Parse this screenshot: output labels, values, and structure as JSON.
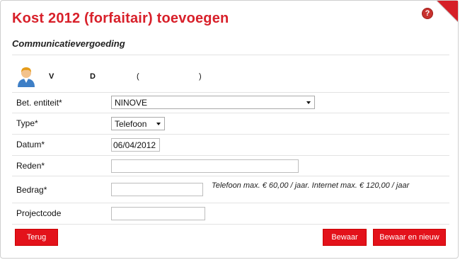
{
  "title": "Kost 2012 (forfaitair) toevoegen",
  "help_label": "?",
  "subtitle": "Communicatievergoeding",
  "person": {
    "first": "V",
    "last": "D",
    "paren_open": "(",
    "paren_close": ")"
  },
  "form": {
    "entity": {
      "label": "Bet. entiteit*",
      "value": "NINOVE"
    },
    "type": {
      "label": "Type*",
      "value": "Telefoon"
    },
    "date": {
      "label": "Datum*",
      "value": "06/04/2012"
    },
    "reason": {
      "label": "Reden*",
      "value": ""
    },
    "amount": {
      "label": "Bedrag*",
      "value": "",
      "hint": "Telefoon max. € 60,00 / jaar. Internet max. € 120,00 / jaar"
    },
    "project": {
      "label": "Projectcode",
      "value": ""
    }
  },
  "buttons": {
    "back": "Terug",
    "save": "Bewaar",
    "save_new": "Bewaar en nieuw"
  },
  "colors": {
    "accent": "#e3121b",
    "title": "#d8202a"
  }
}
